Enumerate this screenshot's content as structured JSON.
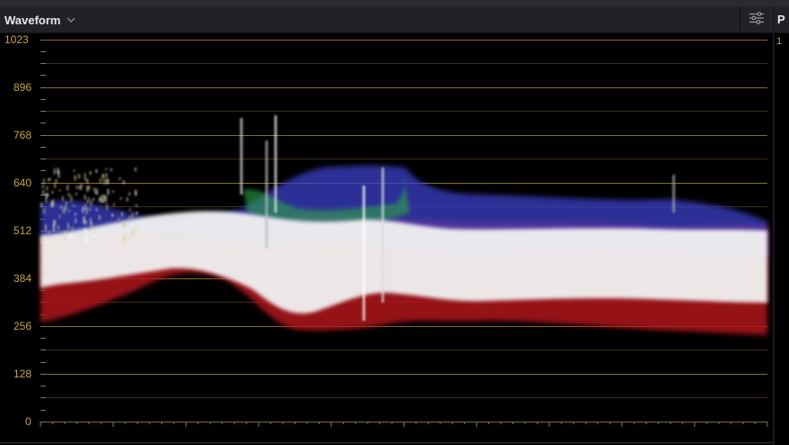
{
  "panel": {
    "title": "Waveform",
    "settings_icon": "sliders-icon",
    "chevron_icon": "chevron-down-icon"
  },
  "right_panel": {
    "title_fragment": "P",
    "sub_fragment": "1"
  },
  "scale": {
    "labels": [
      "1023",
      "896",
      "768",
      "640",
      "512",
      "384",
      "256",
      "128",
      "0"
    ],
    "label_values": [
      1023,
      896,
      768,
      640,
      512,
      384,
      256,
      128,
      0
    ],
    "max": 1023
  },
  "colors": {
    "label": "#c9a24a",
    "gridline": "#8a6a26",
    "header_bg": "#222226",
    "scope_bg": "#000000"
  }
}
